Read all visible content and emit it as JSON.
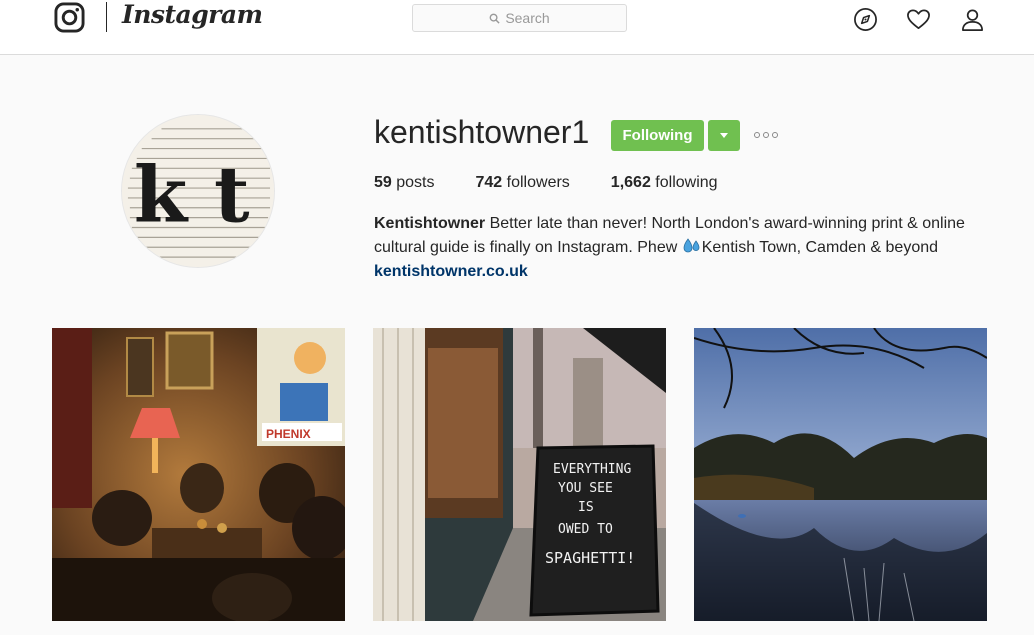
{
  "topbar": {
    "brand": "Instagram",
    "search_placeholder": "Search",
    "icons": [
      "instagram-logo-icon",
      "search-icon",
      "compass-icon",
      "heart-icon",
      "user-icon"
    ]
  },
  "profile": {
    "username": "kentishtowner1",
    "avatar_text": "k t",
    "follow_button": "Following",
    "posts_count": "59",
    "posts_label": "posts",
    "followers_count": "742",
    "followers_label": "followers",
    "following_count": "1,662",
    "following_label": "following",
    "bio_name": "Kentishtowner",
    "bio_text_1": "Better late than never! North London's award-winning print & online cultural guide is finally on Instagram. Phew",
    "bio_text_2": "Kentish Town, Camden & beyond",
    "website": "kentishtowner.co.uk"
  },
  "posts": [
    {
      "subject": "pub music session",
      "poster_text": "PHENIX"
    },
    {
      "subject": "storefront chalkboard",
      "board_text": [
        "EVERYTHING",
        "YOU SEE",
        "IS",
        "OWED TO",
        "SPAGHETTI!"
      ]
    },
    {
      "subject": "pond at dusk"
    }
  ],
  "colors": {
    "following_green": "#70c050",
    "link_blue": "#003569",
    "border": "#dbdbdb"
  }
}
